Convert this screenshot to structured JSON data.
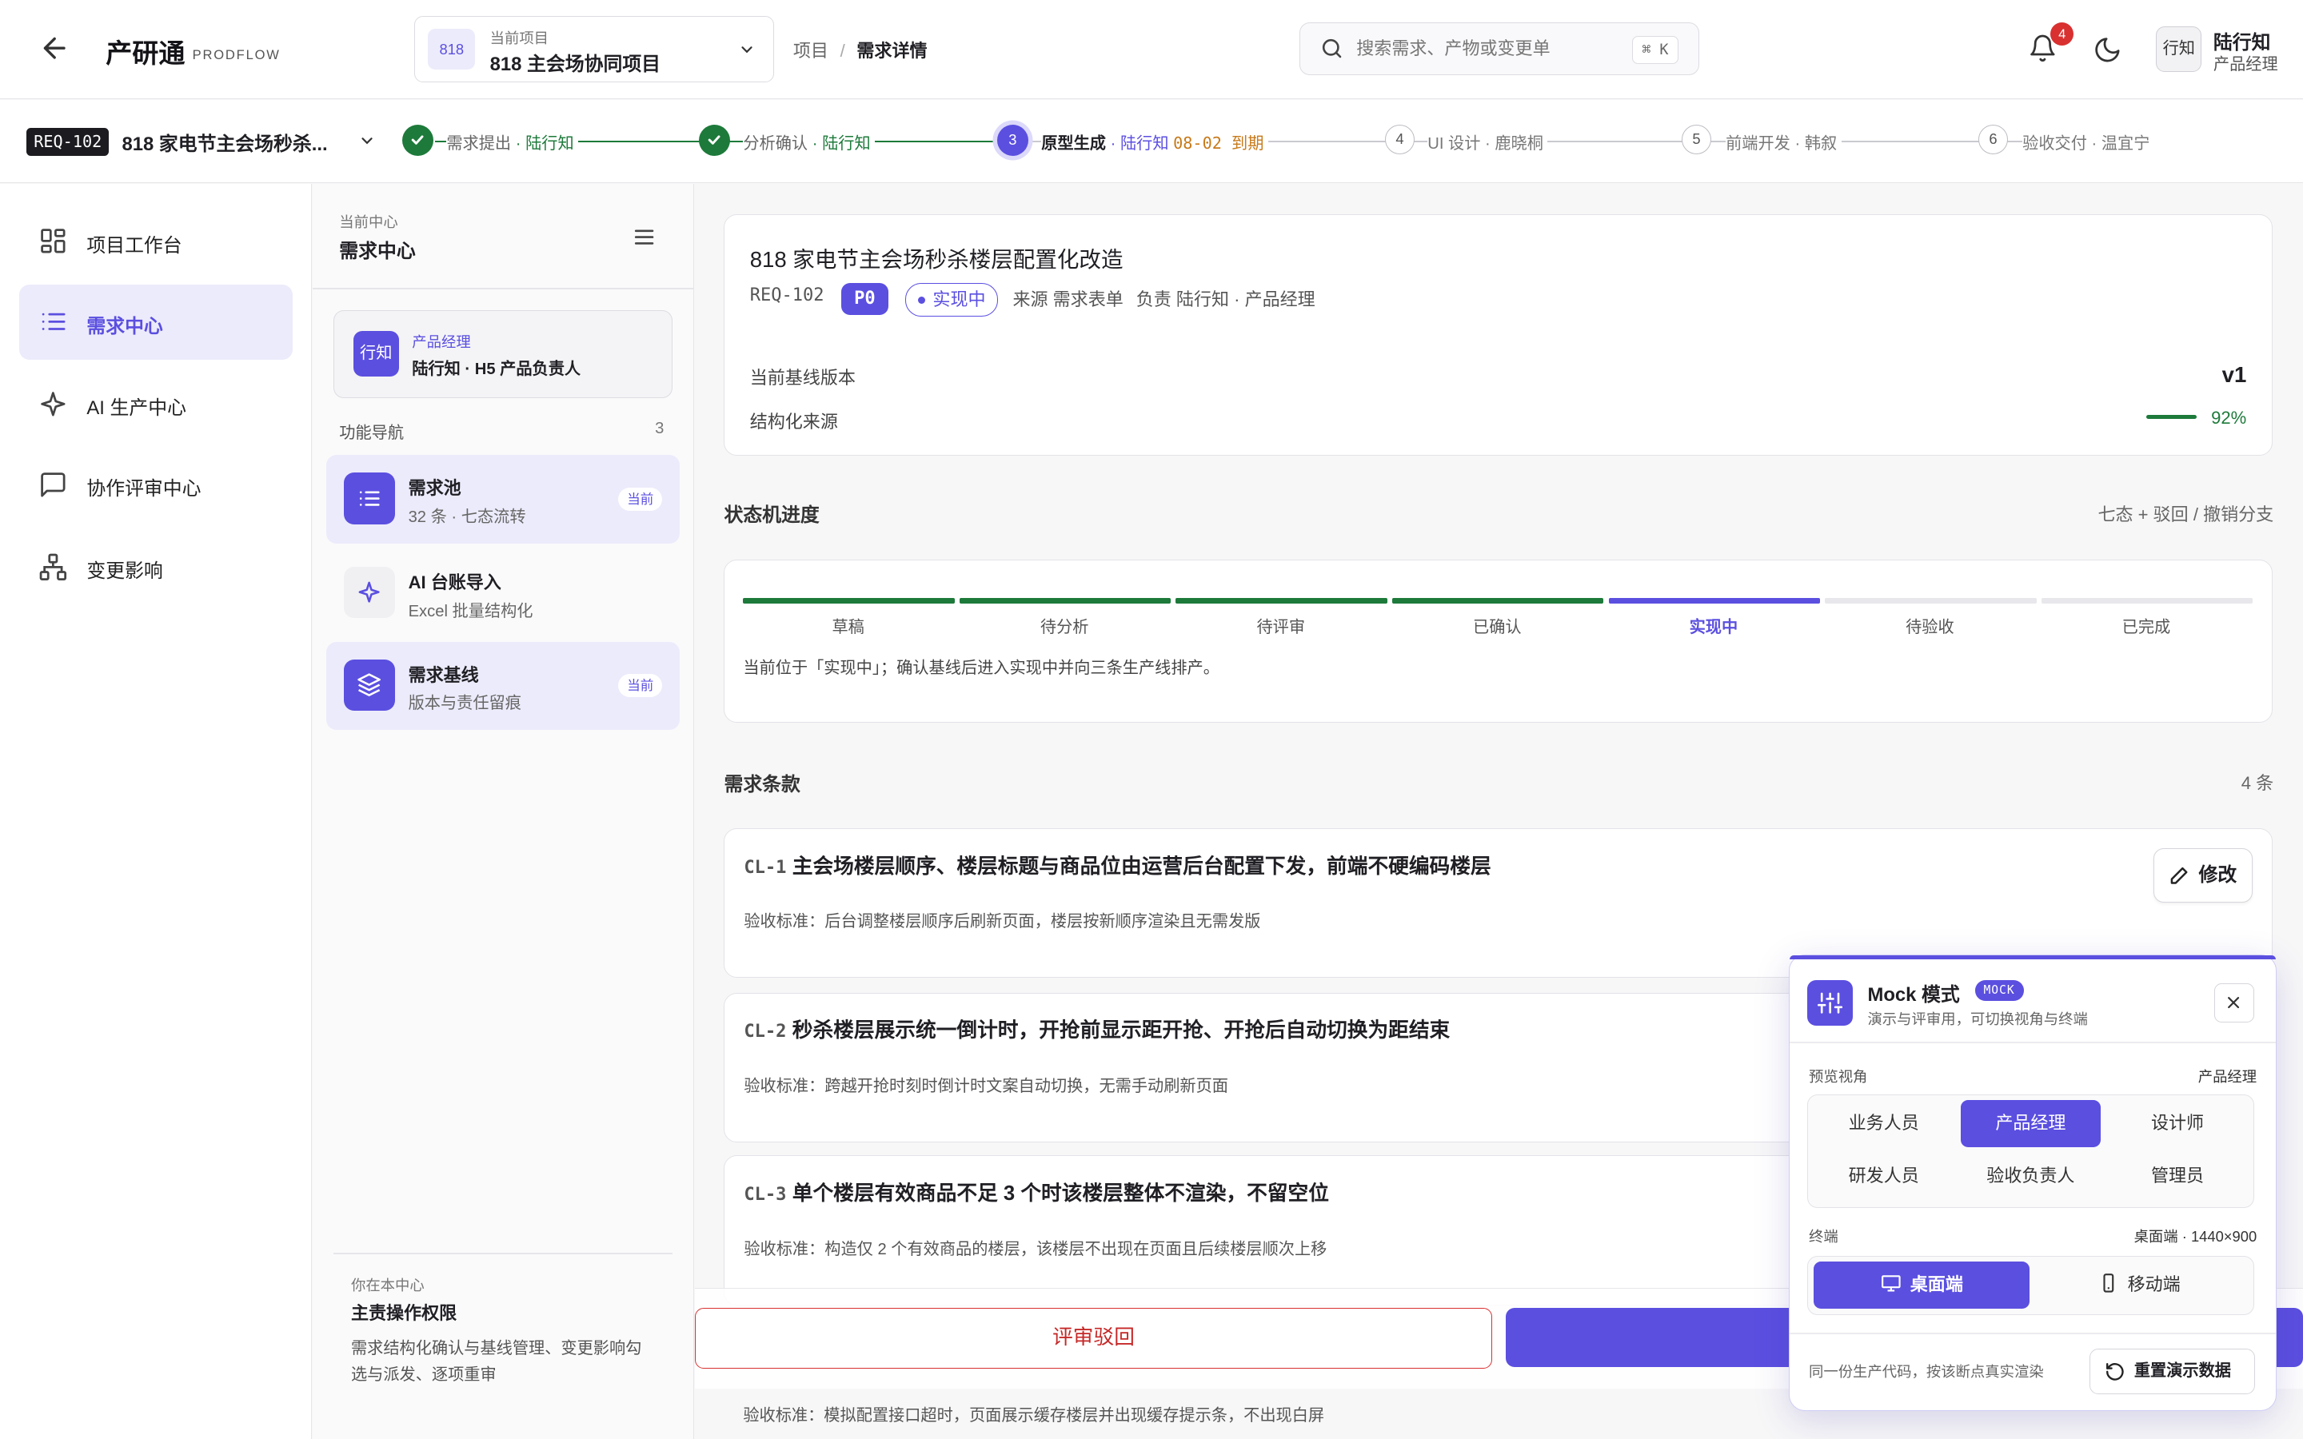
{
  "header": {
    "brand": "产研通",
    "brand_sub": "PRODFLOW",
    "project": {
      "badge": "818",
      "caption": "当前项目",
      "name": "818 主会场协同项目"
    },
    "breadcrumb": [
      "项目",
      "需求详情"
    ],
    "search": {
      "placeholder": "搜索需求、产物或变更单",
      "shortcut": "⌘ K"
    },
    "notifications": "4",
    "user": {
      "avatar": "行知",
      "name": "陆行知",
      "role": "产品经理"
    }
  },
  "flow": {
    "req_id": "REQ-102",
    "req_title": "818 家电节主会场秒杀...",
    "steps": [
      {
        "num": "1",
        "label": "需求提出",
        "owner": "陆行知",
        "state": "done"
      },
      {
        "num": "2",
        "label": "分析确认",
        "owner": "陆行知",
        "state": "done"
      },
      {
        "num": "3",
        "label": "原型生成",
        "owner": "陆行知",
        "due": "08-02 到期",
        "state": "current"
      },
      {
        "num": "4",
        "label": "UI 设计",
        "owner": "鹿晓桐",
        "state": "todo"
      },
      {
        "num": "5",
        "label": "前端开发",
        "owner": "韩叙",
        "state": "todo"
      },
      {
        "num": "6",
        "label": "验收交付",
        "owner": "温宜宁",
        "state": "todo"
      }
    ]
  },
  "nav": [
    {
      "label": "项目工作台",
      "icon": "dashboard-icon"
    },
    {
      "label": "需求中心",
      "icon": "list-icon",
      "active": true
    },
    {
      "label": "AI 生产中心",
      "icon": "sparkle-icon"
    },
    {
      "label": "协作评审中心",
      "icon": "chat-icon"
    },
    {
      "label": "变更影响",
      "icon": "hierarchy-icon"
    }
  ],
  "panel": {
    "caption": "当前中心",
    "title": "需求中心",
    "owner": {
      "badge": "行知",
      "role": "产品经理",
      "name": "陆行知 · H5 产品负责人"
    },
    "fn_title": "功能导航",
    "fn_count": "3",
    "functions": [
      {
        "name": "需求池",
        "sub": "32 条 · 七态流转",
        "tag": "当前"
      },
      {
        "name": "AI 台账导入",
        "sub": "Excel 批量结构化"
      },
      {
        "name": "需求基线",
        "sub": "版本与责任留痕",
        "tag": "当前"
      }
    ],
    "foot": {
      "caption": "你在本中心",
      "title": "主责操作权限",
      "desc": "需求结构化确认与基线管理、变更影响勾选与派发、逐项重审"
    }
  },
  "detail": {
    "title": "818 家电节主会场秒杀楼层配置化改造",
    "id": "REQ-102",
    "priority": "P0",
    "state": "实现中",
    "source": "来源 需求表单",
    "owner": "负责 陆行知 · 产品经理",
    "baseline_label": "当前基线版本",
    "baseline_value": "v1",
    "struct_label": "结构化来源",
    "struct_pct": "92%",
    "struct_progress": 0.92
  },
  "state_machine": {
    "title": "状态机进度",
    "right": "七态 + 驳回 / 撤销分支",
    "states": [
      "草稿",
      "待分析",
      "待评审",
      "已确认",
      "实现中",
      "待验收",
      "已完成"
    ],
    "current_index": 4,
    "note": "当前位于「实现中」；确认基线后进入实现中并向三条生产线排产。"
  },
  "clauses": {
    "title": "需求条款",
    "count": "4 条",
    "edit_label": "修改",
    "items": [
      {
        "id": "CL-1",
        "title": "主会场楼层顺序、楼层标题与商品位由运营后台配置下发，前端不硬编码楼层",
        "acc": "验收标准：后台调整楼层顺序后刷新页面，楼层按新顺序渲染且无需发版"
      },
      {
        "id": "CL-2",
        "title": "秒杀楼层展示统一倒计时，开抢前显示距开抢、开抢后自动切换为距结束",
        "acc": "验收标准：跨越开抢时刻时倒计时文案自动切换，无需手动刷新页面"
      },
      {
        "id": "CL-3",
        "title": "单个楼层有效商品不足 3 个时该楼层整体不渲染，不留空位",
        "acc": "验收标准：构造仅 2 个有效商品的楼层，该楼层不出现在页面且后续楼层顺次上移"
      }
    ],
    "last_acc": "验收标准：模拟配置接口超时，页面展示缓存楼层并出现缓存提示条，不出现白屏"
  },
  "actions": {
    "reject": "评审驳回"
  },
  "mock": {
    "title": "Mock 模式",
    "tag": "MOCK",
    "sub": "演示与评审用，可切换视角与终端",
    "view_label": "预览视角",
    "view_value": "产品经理",
    "roles": [
      "业务人员",
      "产品经理",
      "设计师",
      "研发人员",
      "验收负责人",
      "管理员"
    ],
    "role_selected": 1,
    "term_label": "终端",
    "term_value": "桌面端 · 1440×900",
    "terminals": [
      "桌面端",
      "移动端"
    ],
    "term_selected": 0,
    "foot": "同一份生产代码，按该断点真实渲染",
    "reset": "重置演示数据"
  },
  "colors": {
    "accent": "#5b4fe0",
    "done": "#1d7a3a",
    "danger": "#d93030",
    "due": "#c77a1a"
  }
}
